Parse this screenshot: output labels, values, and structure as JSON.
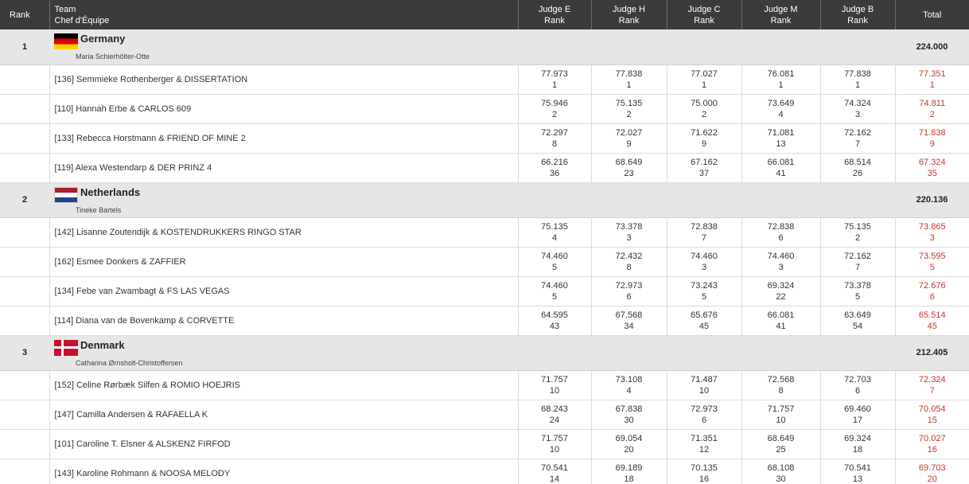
{
  "header": {
    "rank": "Rank",
    "team_line1": "Team",
    "team_line2": "Chef d'Équipe",
    "judges": [
      {
        "line1": "Judge E",
        "line2": "Rank"
      },
      {
        "line1": "Judge H",
        "line2": "Rank"
      },
      {
        "line1": "Judge C",
        "line2": "Rank"
      },
      {
        "line1": "Judge M",
        "line2": "Rank"
      },
      {
        "line1": "Judge B",
        "line2": "Rank"
      }
    ],
    "total": "Total"
  },
  "teams": [
    {
      "rank": "1",
      "country": "Germany",
      "flag": "flag-de",
      "chef": "Maria Schierhölter-Otte",
      "total": "224.000",
      "riders": [
        {
          "name": "[136] Semmieke Rothenberger & DISSERTATION",
          "scores": [
            [
              "77.973",
              "1"
            ],
            [
              "77.838",
              "1"
            ],
            [
              "77.027",
              "1"
            ],
            [
              "76.081",
              "1"
            ],
            [
              "77.838",
              "1"
            ]
          ],
          "total": [
            "77.351",
            "1"
          ]
        },
        {
          "name": "[110] Hannah Erbe & CARLOS 609",
          "scores": [
            [
              "75.946",
              "2"
            ],
            [
              "75.135",
              "2"
            ],
            [
              "75.000",
              "2"
            ],
            [
              "73.649",
              "4"
            ],
            [
              "74.324",
              "3"
            ]
          ],
          "total": [
            "74.811",
            "2"
          ]
        },
        {
          "name": "[133] Rebecca Horstmann & FRIEND OF MINE 2",
          "scores": [
            [
              "72.297",
              "8"
            ],
            [
              "72.027",
              "9"
            ],
            [
              "71.622",
              "9"
            ],
            [
              "71.081",
              "13"
            ],
            [
              "72.162",
              "7"
            ]
          ],
          "total": [
            "71.838",
            "9"
          ]
        },
        {
          "name": "[119] Alexa Westendarp & DER PRINZ 4",
          "scores": [
            [
              "66.216",
              "36"
            ],
            [
              "68.649",
              "23"
            ],
            [
              "67.162",
              "37"
            ],
            [
              "66.081",
              "41"
            ],
            [
              "68.514",
              "26"
            ]
          ],
          "total": [
            "67.324",
            "35"
          ]
        }
      ]
    },
    {
      "rank": "2",
      "country": "Netherlands",
      "flag": "flag-nl",
      "chef": "Tineke Bartels",
      "total": "220.136",
      "riders": [
        {
          "name": "[142] Lisanne Zoutendijk & KOSTENDRUKKERS RINGO STAR",
          "scores": [
            [
              "75.135",
              "4"
            ],
            [
              "73.378",
              "3"
            ],
            [
              "72.838",
              "7"
            ],
            [
              "72.838",
              "6"
            ],
            [
              "75.135",
              "2"
            ]
          ],
          "total": [
            "73.865",
            "3"
          ]
        },
        {
          "name": "[162] Esmee Donkers & ZAFFIER",
          "scores": [
            [
              "74.460",
              "5"
            ],
            [
              "72.432",
              "8"
            ],
            [
              "74.460",
              "3"
            ],
            [
              "74.460",
              "3"
            ],
            [
              "72.162",
              "7"
            ]
          ],
          "total": [
            "73.595",
            "5"
          ]
        },
        {
          "name": "[134] Febe van Zwambagt & FS LAS VEGAS",
          "scores": [
            [
              "74.460",
              "5"
            ],
            [
              "72.973",
              "6"
            ],
            [
              "73.243",
              "5"
            ],
            [
              "69.324",
              "22"
            ],
            [
              "73.378",
              "5"
            ]
          ],
          "total": [
            "72.676",
            "6"
          ]
        },
        {
          "name": "[114] Diana van de Bovenkamp & CORVETTE",
          "scores": [
            [
              "64.595",
              "43"
            ],
            [
              "67.568",
              "34"
            ],
            [
              "65.676",
              "45"
            ],
            [
              "66.081",
              "41"
            ],
            [
              "63.649",
              "54"
            ]
          ],
          "total": [
            "65.514",
            "45"
          ]
        }
      ]
    },
    {
      "rank": "3",
      "country": "Denmark",
      "flag": "flag-dk",
      "chef": "Catharina Ørnsholt-Christoffersen",
      "total": "212.405",
      "riders": [
        {
          "name": "[152] Celine Rørbæk Silfen & ROMIO HOEJRIS",
          "scores": [
            [
              "71.757",
              "10"
            ],
            [
              "73.108",
              "4"
            ],
            [
              "71.487",
              "10"
            ],
            [
              "72.568",
              "8"
            ],
            [
              "72.703",
              "6"
            ]
          ],
          "total": [
            "72.324",
            "7"
          ]
        },
        {
          "name": "[147] Camilla Andersen & RAFAELLA K",
          "scores": [
            [
              "68.243",
              "24"
            ],
            [
              "67.838",
              "30"
            ],
            [
              "72.973",
              "6"
            ],
            [
              "71.757",
              "10"
            ],
            [
              "69.460",
              "17"
            ]
          ],
          "total": [
            "70.054",
            "15"
          ]
        },
        {
          "name": "[101] Caroline T. Elsner & ALSKENZ FIRFOD",
          "scores": [
            [
              "71.757",
              "10"
            ],
            [
              "69.054",
              "20"
            ],
            [
              "71.351",
              "12"
            ],
            [
              "68.649",
              "25"
            ],
            [
              "69.324",
              "18"
            ]
          ],
          "total": [
            "70.027",
            "16"
          ]
        },
        {
          "name": "[143] Karoline Rohmann & NOOSA MELODY",
          "scores": [
            [
              "70.541",
              "14"
            ],
            [
              "69.189",
              "18"
            ],
            [
              "70.135",
              "16"
            ],
            [
              "68.108",
              "30"
            ],
            [
              "70.541",
              "13"
            ]
          ],
          "total": [
            "69.703",
            "20"
          ]
        }
      ]
    }
  ]
}
